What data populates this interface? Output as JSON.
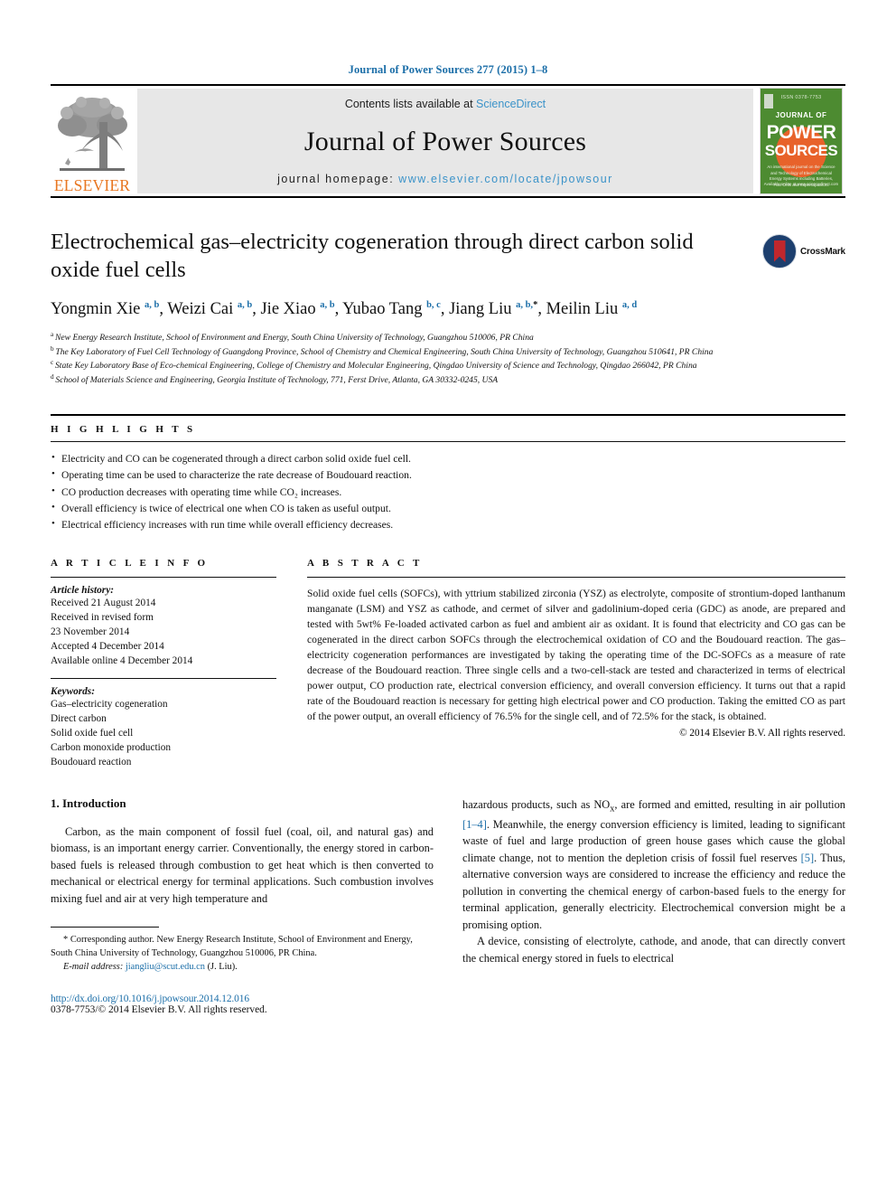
{
  "running_head": "Journal of Power Sources 277 (2015) 1–8",
  "masthead": {
    "contents_prefix": "Contents lists available at ",
    "sciencedirect": "ScienceDirect",
    "journal_title": "Journal of Power Sources",
    "homepage_prefix": "journal homepage: ",
    "homepage_url": "www.elsevier.com/locate/jpowsour",
    "publisher": "ELSEVIER",
    "cover": {
      "line1": "ISSN 0378-7753",
      "line2": "JOURNAL OF",
      "line3": "POWER",
      "line4": "SOURCES",
      "line5": "An international journal on the Science and Technology of Electrochemical Energy Systems including Batteries, Fuel Cells and Supercapacitors",
      "line6": "Available online at www.sciencedirect.com"
    }
  },
  "article": {
    "title": "Electrochemical gas–electricity cogeneration through direct carbon solid oxide fuel cells",
    "crossmark_label": "CrossMark",
    "authors": [
      {
        "name": "Yongmin Xie",
        "sup": "a, b",
        "star": false
      },
      {
        "name": "Weizi Cai",
        "sup": "a, b",
        "star": false
      },
      {
        "name": "Jie Xiao",
        "sup": "a, b",
        "star": false
      },
      {
        "name": "Yubao Tang",
        "sup": "b, c",
        "star": false
      },
      {
        "name": "Jiang Liu",
        "sup": "a, b,",
        "star": true
      },
      {
        "name": "Meilin Liu",
        "sup": "a, d",
        "star": false
      }
    ],
    "affiliations": [
      {
        "mark": "a",
        "text": "New Energy Research Institute, School of Environment and Energy, South China University of Technology, Guangzhou 510006, PR China"
      },
      {
        "mark": "b",
        "text": "The Key Laboratory of Fuel Cell Technology of Guangdong Province, School of Chemistry and Chemical Engineering, South China University of Technology, Guangzhou 510641, PR China"
      },
      {
        "mark": "c",
        "text": "State Key Laboratory Base of Eco-chemical Engineering, College of Chemistry and Molecular Engineering, Qingdao University of Science and Technology, Qingdao 266042, PR China"
      },
      {
        "mark": "d",
        "text": "School of Materials Science and Engineering, Georgia Institute of Technology, 771, Ferst Drive, Atlanta, GA 30332-0245, USA"
      }
    ]
  },
  "highlights": {
    "heading": "H I G H L I G H T S",
    "items": [
      "Electricity and CO can be cogenerated through a direct carbon solid oxide fuel cell.",
      "Operating time can be used to characterize the rate decrease of Boudouard reaction.",
      "CO production decreases with operating time while CO₂ increases.",
      "Overall efficiency is twice of electrical one when CO is taken as useful output.",
      "Electrical efficiency increases with run time while overall efficiency decreases."
    ]
  },
  "article_info": {
    "heading": "A R T I C L E   I N F O",
    "history_label": "Article history:",
    "history": [
      "Received 21 August 2014",
      "Received in revised form",
      "23 November 2014",
      "Accepted 4 December 2014",
      "Available online 4 December 2014"
    ],
    "keywords_label": "Keywords:",
    "keywords": [
      "Gas–electricity cogeneration",
      "Direct carbon",
      "Solid oxide fuel cell",
      "Carbon monoxide production",
      "Boudouard reaction"
    ]
  },
  "abstract": {
    "heading": "A B S T R A C T",
    "text": "Solid oxide fuel cells (SOFCs), with yttrium stabilized zirconia (YSZ) as electrolyte, composite of strontium-doped lanthanum manganate (LSM) and YSZ as cathode, and cermet of silver and gadolinium-doped ceria (GDC) as anode, are prepared and tested with 5wt% Fe-loaded activated carbon as fuel and ambient air as oxidant. It is found that electricity and CO gas can be cogenerated in the direct carbon SOFCs through the electrochemical oxidation of CO and the Boudouard reaction. The gas–electricity cogeneration performances are investigated by taking the operating time of the DC-SOFCs as a measure of rate decrease of the Boudouard reaction. Three single cells and a two-cell-stack are tested and characterized in terms of electrical power output, CO production rate, electrical conversion efficiency, and overall conversion efficiency. It turns out that a rapid rate of the Boudouard reaction is necessary for getting high electrical power and CO production. Taking the emitted CO as part of the power output, an overall efficiency of 76.5% for the single cell, and of 72.5% for the stack, is obtained.",
    "copyright": "© 2014 Elsevier B.V. All rights reserved."
  },
  "introduction": {
    "heading": "1.  Introduction",
    "paragraph1": "Carbon, as the main component of fossil fuel (coal, oil, and natural gas) and biomass, is an important energy carrier. Conventionally, the energy stored in carbon-based fuels is released through combustion to get heat which is then converted to mechanical or electrical energy for terminal applications. Such combustion involves mixing fuel and air at very high temperature and",
    "right_part1_a": "hazardous products, such as NO",
    "right_part1_sub": "x",
    "right_part1_b": ", are formed and emitted, resulting in air pollution ",
    "ref_1_4": "[1–4]",
    "right_part1_c": ". Meanwhile, the energy conversion efficiency is limited, leading to significant waste of fuel and large production of green house gases which cause the global climate change, not to mention the depletion crisis of fossil fuel reserves ",
    "ref_5": "[5]",
    "right_part1_d": ". Thus, alternative conversion ways are considered to increase the efficiency and reduce the pollution in converting the chemical energy of carbon-based fuels to the energy for terminal application, generally electricity. Electrochemical conversion might be a promising option.",
    "right_paragraph2": "A device, consisting of electrolyte, cathode, and anode, that can directly convert the chemical energy stored in fuels to electrical"
  },
  "footnote": {
    "star": "*",
    "corresponding": "Corresponding author. New Energy Research Institute, School of Environment and Energy, South China University of Technology, Guangzhou 510006, PR China.",
    "email_label": "E-mail address:",
    "email": "jiangliu@scut.edu.cn",
    "email_suffix": "(J. Liu).",
    "doi": "http://dx.doi.org/10.1016/j.jpowsour.2014.12.016",
    "issn": "0378-7753/© 2014 Elsevier B.V. All rights reserved."
  },
  "colors": {
    "link_blue": "#1b6ea8",
    "sciencedirect_blue": "#3b93c9",
    "elsevier_orange": "#e87722",
    "cover_green": "#4d8b31",
    "crossmark_navy": "#1d3f6e",
    "crossmark_red": "#c1272d"
  }
}
